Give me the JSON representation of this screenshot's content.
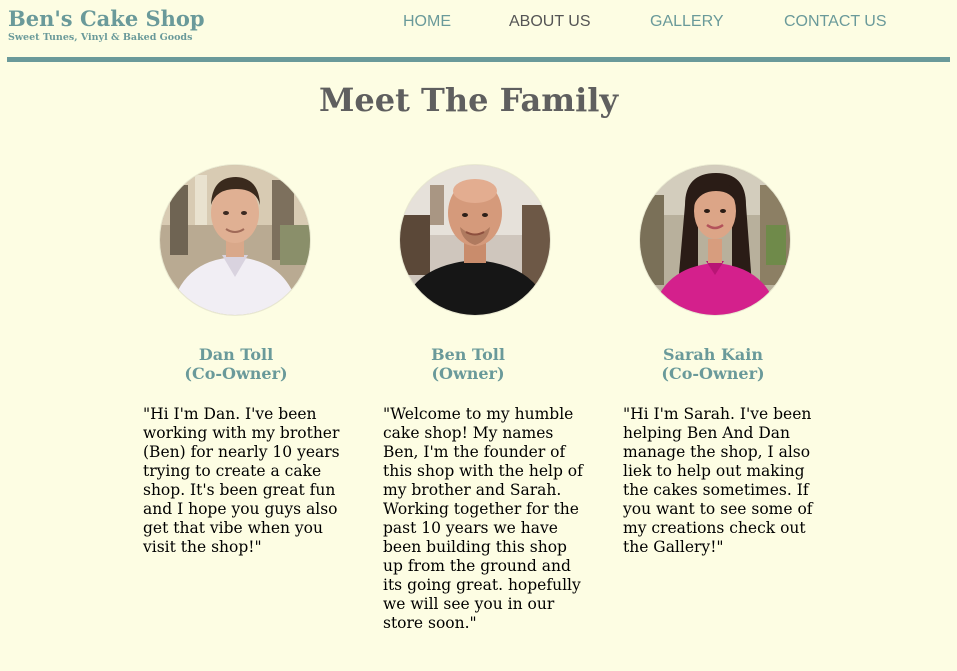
{
  "site": {
    "title": "Ben's Cake Shop",
    "tagline": "Sweet Tunes, Vinyl & Baked Goods"
  },
  "nav": {
    "items": [
      {
        "label": "HOME",
        "active": false
      },
      {
        "label": "ABOUT US",
        "active": true
      },
      {
        "label": "GALLERY",
        "active": false
      },
      {
        "label": "CONTACT US",
        "active": false
      }
    ]
  },
  "page": {
    "title": "Meet The Family"
  },
  "members": [
    {
      "name": "Dan Toll",
      "role": "(Co-Owner)",
      "quote": "\"Hi I'm Dan. I've been working with my brother (Ben) for nearly 10 years trying to create a cake shop. It's been great fun and I hope you guys also get that vibe when you visit the shop!\""
    },
    {
      "name": "Ben Toll",
      "role": "(Owner)",
      "quote": "\"Welcome to my humble cake shop! My names Ben, I'm the founder of this shop with the help of my brother and Sarah. Working together for the past 10 years we have been building this shop up from the ground and its going great. hopefully we will see you in our store soon.\""
    },
    {
      "name": "Sarah Kain",
      "role": "(Co-Owner)",
      "quote": "\"Hi I'm Sarah. I've been helping Ben And Dan manage the shop, I also liek to help out making the cakes sometimes. If you want to see some of my creations check out the Gallery!\""
    }
  ],
  "colors": {
    "background": "#fdfde3",
    "accent": "#6a9a9a",
    "title": "#5f5f5f",
    "nav_active": "#555555"
  }
}
